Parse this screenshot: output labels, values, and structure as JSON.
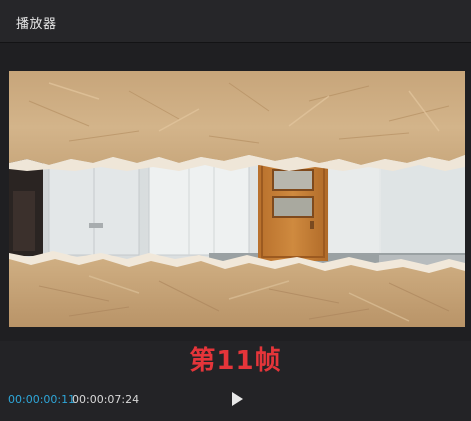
{
  "window": {
    "title": "播放器"
  },
  "video": {
    "scene": "paper-tear-transition-hallway-door"
  },
  "overlay": {
    "frame_label": "第11帧",
    "frame_label_color": "#e5353a"
  },
  "controls": {
    "current_time": "00:00:00:11",
    "total_time": "00:00:07:24",
    "play_icon": "play-icon",
    "current_time_color": "#2ea6d8"
  }
}
